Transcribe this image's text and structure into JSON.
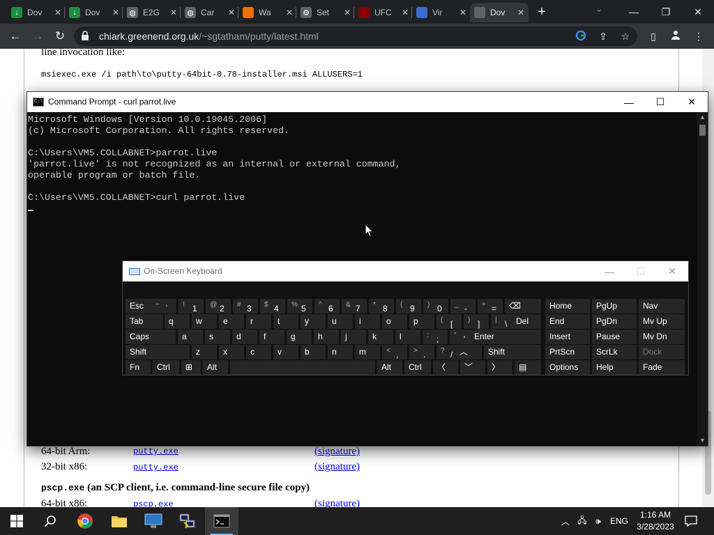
{
  "browser": {
    "tabs": [
      {
        "title": "Dov",
        "icon": "download-icon",
        "color": "#1e8e3e"
      },
      {
        "title": "Dov",
        "icon": "download-icon",
        "color": "#1e8e3e"
      },
      {
        "title": "E2G",
        "icon": "globe-icon",
        "color": "#5f6368"
      },
      {
        "title": "Car",
        "icon": "globe-icon",
        "color": "#5f6368"
      },
      {
        "title": "Wa",
        "icon": "site-logo-icon",
        "color": "#e8710a"
      },
      {
        "title": "Set",
        "icon": "gear-icon",
        "color": "#5f6368"
      },
      {
        "title": "UFC",
        "icon": "ufc-logo-icon",
        "color": "#8b0000"
      },
      {
        "title": "Vir",
        "icon": "vscode-icon",
        "color": "#3e6ad6"
      },
      {
        "title": "Dov",
        "icon": "putty-icon",
        "color": "#5f6368",
        "active": true
      }
    ],
    "url_host": "chiark.greenend.org.uk",
    "url_path": "/~sgtatham/putty/latest.html"
  },
  "webpage": {
    "line_invocation": "line invocation like:",
    "msiexec": "msiexec.exe /i path\\to\\putty-64bit-0.78-installer.msi ALLUSERS=1",
    "rows": [
      {
        "label": "64-bit Arm:",
        "file": "putty.exe",
        "sig": "(signature)"
      },
      {
        "label": "32-bit x86:",
        "file": "putty.exe",
        "sig": "(signature)"
      }
    ],
    "pscp_heading_code": "pscp.exe",
    "pscp_heading_rest": " (an SCP client, i.e. command-line secure file copy)",
    "pscp_row": {
      "label": "64-bit x86:",
      "file": "pscp.exe",
      "sig": "(signature)"
    }
  },
  "cmd": {
    "title": "Command Prompt - curl  parrot.live",
    "lines": [
      "Microsoft Windows [Version 10.0.19045.2006]",
      "(c) Microsoft Corporation. All rights reserved.",
      "",
      "C:\\Users\\VM5.COLLABNET>parrot.live",
      "'parrot.live' is not recognized as an internal or external command,",
      "operable program or batch file.",
      "",
      "C:\\Users\\VM5.COLLABNET>curl parrot.live"
    ]
  },
  "osk": {
    "title": "On-Screen Keyboard",
    "rows": [
      [
        {
          "main": "Esc"
        },
        {
          "shift": "~",
          "main": "`"
        },
        {
          "shift": "!",
          "main": "1"
        },
        {
          "shift": "@",
          "main": "2"
        },
        {
          "shift": "#",
          "main": "3"
        },
        {
          "shift": "$",
          "main": "4"
        },
        {
          "shift": "%",
          "main": "5"
        },
        {
          "shift": "^",
          "main": "6"
        },
        {
          "shift": "&",
          "main": "7"
        },
        {
          "shift": "*",
          "main": "8"
        },
        {
          "shift": "(",
          "main": "9"
        },
        {
          "shift": ")",
          "main": "0"
        },
        {
          "shift": "_",
          "main": "-"
        },
        {
          "shift": "+",
          "main": "="
        },
        {
          "main": "⌫"
        }
      ],
      [
        {
          "main": "Tab"
        },
        {
          "main": "q"
        },
        {
          "main": "w"
        },
        {
          "main": "e"
        },
        {
          "main": "r"
        },
        {
          "main": "t"
        },
        {
          "main": "y"
        },
        {
          "main": "u"
        },
        {
          "main": "i"
        },
        {
          "main": "o"
        },
        {
          "main": "p"
        },
        {
          "shift": "{",
          "main": "["
        },
        {
          "shift": "}",
          "main": "]"
        },
        {
          "shift": "|",
          "main": "\\"
        },
        {
          "main": "Del"
        }
      ],
      [
        {
          "main": "Caps"
        },
        {
          "main": "a"
        },
        {
          "main": "s"
        },
        {
          "main": "d"
        },
        {
          "main": "f"
        },
        {
          "main": "g"
        },
        {
          "main": "h"
        },
        {
          "main": "j"
        },
        {
          "main": "k"
        },
        {
          "main": "l"
        },
        {
          "shift": ":",
          "main": ";"
        },
        {
          "shift": "\"",
          "main": "'"
        },
        {
          "main": "Enter"
        }
      ],
      [
        {
          "main": "Shift"
        },
        {
          "main": "z"
        },
        {
          "main": "x"
        },
        {
          "main": "c"
        },
        {
          "main": "v"
        },
        {
          "main": "b"
        },
        {
          "main": "n"
        },
        {
          "main": "m"
        },
        {
          "shift": "<",
          "main": ","
        },
        {
          "shift": ">",
          "main": "."
        },
        {
          "shift": "?",
          "main": "/"
        },
        {
          "main": "︿"
        },
        {
          "main": "Shift"
        }
      ],
      [
        {
          "main": "Fn"
        },
        {
          "main": "Ctrl"
        },
        {
          "main": "⊞"
        },
        {
          "main": "Alt"
        },
        {
          "main": ""
        },
        {
          "main": "Alt"
        },
        {
          "main": "Ctrl"
        },
        {
          "main": "〈"
        },
        {
          "main": "﹀"
        },
        {
          "main": "〉"
        },
        {
          "main": "▤"
        }
      ]
    ],
    "nav": [
      [
        {
          "main": "Home"
        },
        {
          "main": "PgUp"
        },
        {
          "main": "Nav"
        }
      ],
      [
        {
          "main": "End"
        },
        {
          "main": "PgDn"
        },
        {
          "main": "Mv Up"
        }
      ],
      [
        {
          "main": "Insert"
        },
        {
          "main": "Pause"
        },
        {
          "main": "Mv Dn"
        }
      ],
      [
        {
          "main": "PrtScn"
        },
        {
          "main": "ScrLk"
        },
        {
          "main": "Dock",
          "disabled": true
        }
      ],
      [
        {
          "main": "Options"
        },
        {
          "main": "Help"
        },
        {
          "main": "Fade"
        }
      ]
    ]
  },
  "taskbar": {
    "lang": "ENG",
    "time": "1:16 AM",
    "date": "3/28/2023"
  }
}
